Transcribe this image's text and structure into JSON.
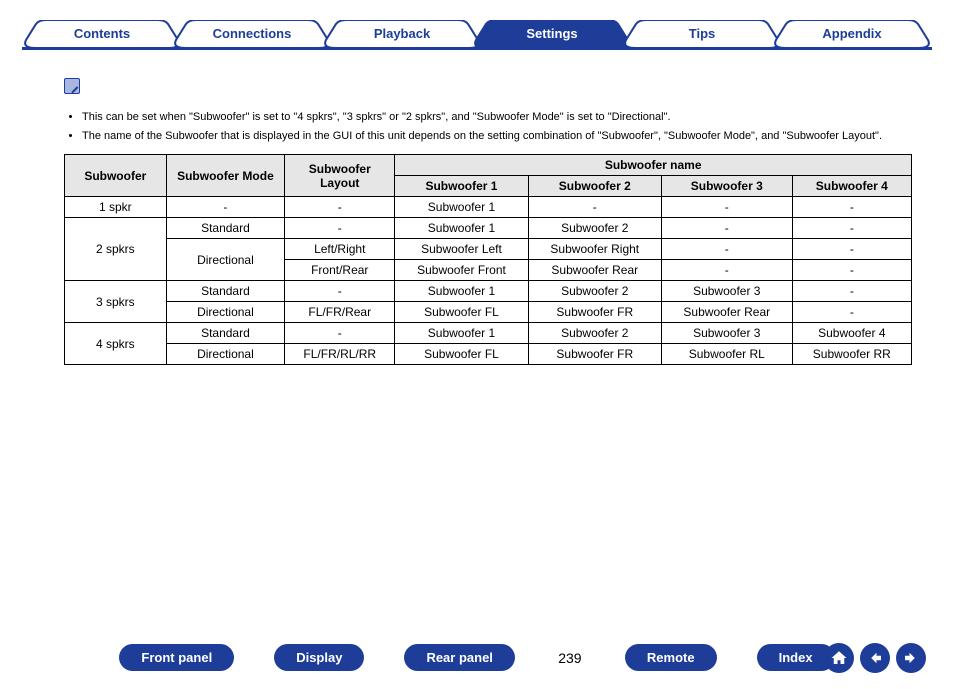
{
  "tabs": {
    "contents": "Contents",
    "connections": "Connections",
    "playback": "Playback",
    "settings": "Settings",
    "tips": "Tips",
    "appendix": "Appendix"
  },
  "notes": {
    "n1": "This can be set when \"Subwoofer\" is set to \"4 spkrs\", \"3 spkrs\" or \"2 spkrs\", and \"Subwoofer Mode\" is set to \"Directional\".",
    "n2": "The name of the Subwoofer that is displayed in the GUI of this unit depends on the setting combination of \"Subwoofer\", \"Subwoofer Mode\", and \"Subwoofer Layout\"."
  },
  "headers": {
    "c1": "Subwoofer",
    "c2": "Subwoofer Mode",
    "c3": "Subwoofer Layout",
    "cg": "Subwoofer name",
    "s1": "Subwoofer 1",
    "s2": "Subwoofer 2",
    "s3": "Subwoofer 3",
    "s4": "Subwoofer 4"
  },
  "rows": {
    "r1": {
      "sub": "1 spkr",
      "mode": "-",
      "layout": "-",
      "n1": "Subwoofer 1",
      "n2": "-",
      "n3": "-",
      "n4": "-"
    },
    "r2": {
      "mode": "Standard",
      "layout": "-",
      "n1": "Subwoofer 1",
      "n2": "Subwoofer 2",
      "n3": "-",
      "n4": "-"
    },
    "r3": {
      "sub": "2 spkrs",
      "mode": "Directional",
      "layout": "Left/Right",
      "n1": "Subwoofer Left",
      "n2": "Subwoofer Right",
      "n3": "-",
      "n4": "-"
    },
    "r4": {
      "layout": "Front/Rear",
      "n1": "Subwoofer Front",
      "n2": "Subwoofer Rear",
      "n3": "-",
      "n4": "-"
    },
    "r5": {
      "sub": "3 spkrs",
      "mode": "Standard",
      "layout": "-",
      "n1": "Subwoofer 1",
      "n2": "Subwoofer 2",
      "n3": "Subwoofer 3",
      "n4": "-"
    },
    "r6": {
      "mode": "Directional",
      "layout": "FL/FR/Rear",
      "n1": "Subwoofer FL",
      "n2": "Subwoofer FR",
      "n3": "Subwoofer Rear",
      "n4": "-"
    },
    "r7": {
      "sub": "4 spkrs",
      "mode": "Standard",
      "layout": "-",
      "n1": "Subwoofer 1",
      "n2": "Subwoofer 2",
      "n3": "Subwoofer 3",
      "n4": "Subwoofer 4"
    },
    "r8": {
      "mode": "Directional",
      "layout": "FL/FR/RL/RR",
      "n1": "Subwoofer FL",
      "n2": "Subwoofer FR",
      "n3": "Subwoofer RL",
      "n4": "Subwoofer RR"
    }
  },
  "bottom": {
    "front": "Front panel",
    "display": "Display",
    "rear": "Rear panel",
    "remote": "Remote",
    "index": "Index",
    "page": "239"
  }
}
